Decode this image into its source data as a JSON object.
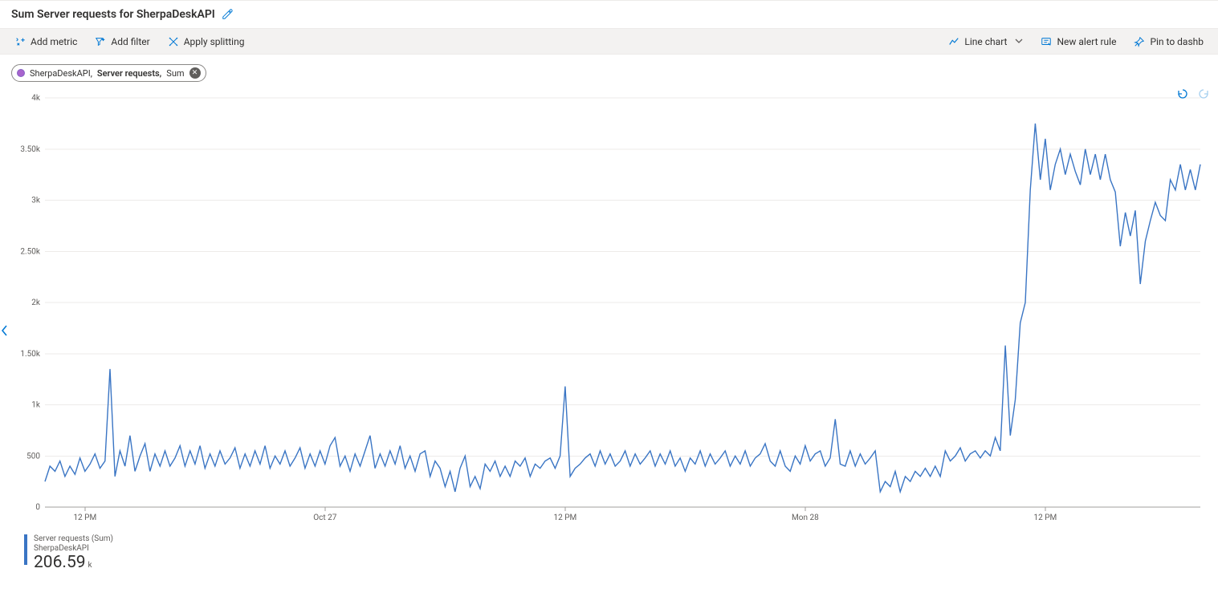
{
  "header": {
    "title": "Sum Server requests for SherpaDeskAPI"
  },
  "toolbar": {
    "add_metric": "Add metric",
    "add_filter": "Add filter",
    "apply_splitting": "Apply splitting",
    "chart_type": "Line chart",
    "new_alert_rule": "New alert rule",
    "pin_to_dashboard": "Pin to dashb"
  },
  "pill": {
    "resource": "SherpaDeskAPI,",
    "metric": "Server requests,",
    "agg": "Sum"
  },
  "legend": {
    "line1": "Server requests (Sum)",
    "line2": "SherpaDeskAPI",
    "value": "206.59",
    "unit": "k"
  },
  "colors": {
    "series": "#3a75c4",
    "accent": "#0078d4"
  },
  "chart_data": {
    "type": "line",
    "title": "Sum Server requests for SherpaDeskAPI",
    "xlabel": "",
    "ylabel": "",
    "ylim": [
      0,
      4000
    ],
    "y_ticks": [
      0,
      500,
      1000,
      1500,
      2000,
      2500,
      3000,
      3500,
      4000
    ],
    "y_tick_labels": [
      "0",
      "500",
      "1k",
      "1.50k",
      "2k",
      "2.50k",
      "3k",
      "3.50k",
      "4k"
    ],
    "x_ticks_indices": [
      8,
      56,
      104,
      152,
      200
    ],
    "x_tick_labels": [
      "12 PM",
      "Oct 27",
      "12 PM",
      "Mon 28",
      "12 PM"
    ],
    "n_points": 232,
    "values": [
      250,
      400,
      350,
      450,
      300,
      400,
      320,
      480,
      350,
      420,
      520,
      380,
      450,
      1350,
      300,
      550,
      400,
      700,
      350,
      500,
      620,
      350,
      520,
      400,
      550,
      400,
      480,
      600,
      400,
      550,
      420,
      600,
      380,
      520,
      400,
      550,
      420,
      480,
      580,
      380,
      520,
      400,
      550,
      420,
      600,
      380,
      500,
      420,
      550,
      400,
      480,
      580,
      380,
      520,
      400,
      550,
      420,
      600,
      680,
      400,
      500,
      350,
      520,
      400,
      550,
      700,
      380,
      520,
      400,
      550,
      420,
      600,
      380,
      500,
      350,
      520,
      550,
      300,
      450,
      380,
      200,
      350,
      150,
      380,
      500,
      200,
      300,
      180,
      420,
      350,
      450,
      300,
      400,
      300,
      450,
      400,
      480,
      300,
      420,
      380,
      450,
      480,
      380,
      500,
      1180,
      300,
      380,
      420,
      480,
      520,
      400,
      550,
      420,
      520,
      400,
      450,
      550,
      400,
      520,
      420,
      480,
      550,
      400,
      520,
      420,
      550,
      400,
      480,
      350,
      480,
      420,
      550,
      400,
      520,
      420,
      480,
      550,
      400,
      500,
      420,
      550,
      400,
      480,
      520,
      620,
      450,
      400,
      550,
      400,
      350,
      500,
      420,
      600,
      450,
      520,
      550,
      400,
      480,
      860,
      420,
      400,
      550,
      400,
      520,
      420,
      480,
      550,
      150,
      250,
      200,
      350,
      150,
      300,
      250,
      350,
      300,
      380,
      300,
      400,
      300,
      550,
      450,
      500,
      580,
      450,
      520,
      550,
      480,
      550,
      500,
      680,
      550,
      1580,
      700,
      1050,
      1800,
      2000,
      3100,
      3750,
      3200,
      3600,
      3100,
      3350,
      3500,
      3250,
      3450,
      3280,
      3150,
      3500,
      3250,
      3450,
      3200,
      3450,
      3200,
      3080,
      2550,
      2880,
      2650,
      2900,
      2180,
      2600,
      2800,
      2980,
      2850,
      2800,
      3200,
      3100,
      3350,
      3100,
      3300,
      3100,
      3350
    ],
    "sum_value_k": 206.59
  }
}
